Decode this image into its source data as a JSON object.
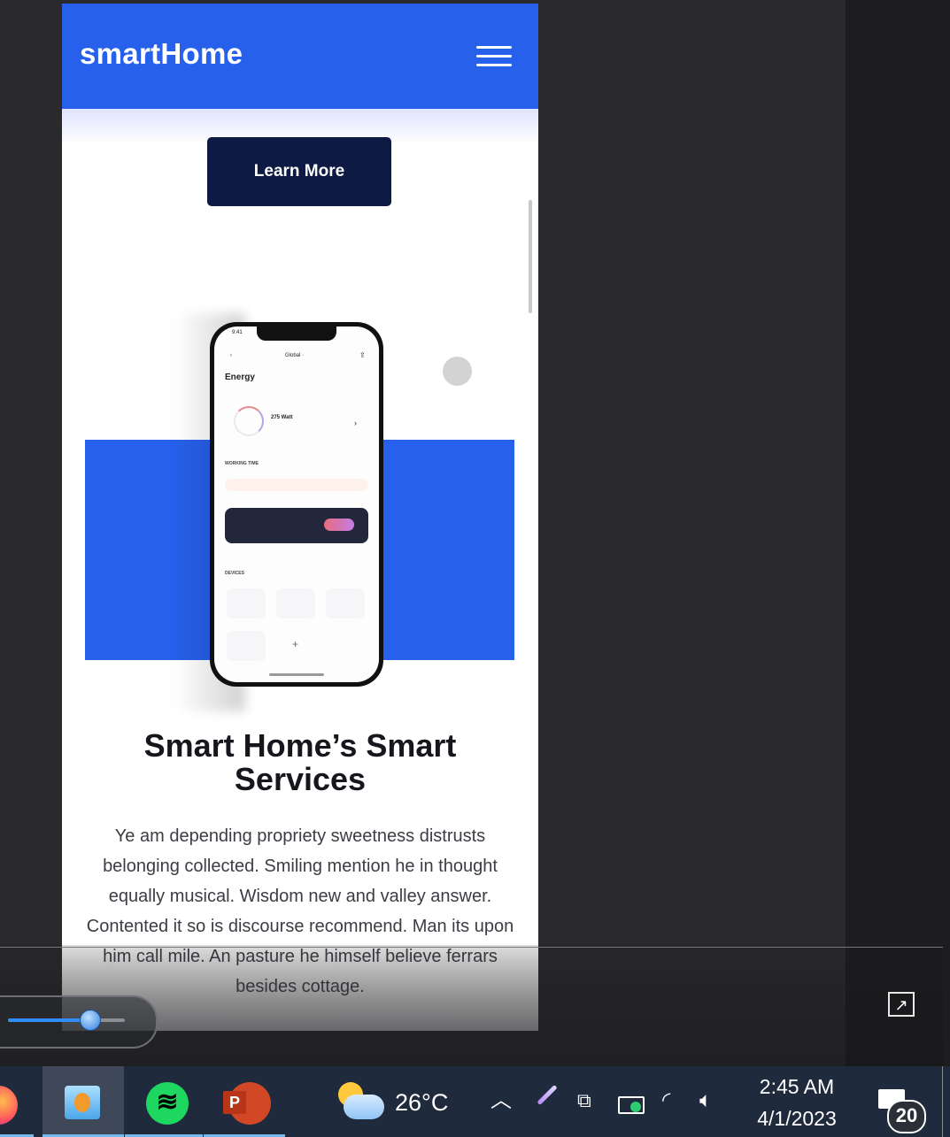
{
  "app": {
    "brand": "smartHome",
    "menu_icon": "hamburger-icon",
    "learn_more_label": "Learn More"
  },
  "phone_mockup": {
    "status_time": "9:41",
    "nav_center": "Global ·",
    "screen_title": "Energy",
    "watt_value": "275 Watt",
    "working_time_label": "WORKING TIME",
    "devices_label": "DEVICES"
  },
  "section": {
    "title": "Smart Home’s Smart Services",
    "body": "Ye am depending propriety sweetness distrusts belonging collected. Smiling mention he in thought equally musical. Wisdom new and valley answer. Contented it so is discourse recommend. Man its upon him call mile. An pasture he himself believe ferrars besides cottage."
  },
  "player": {
    "volume_percent": 70,
    "popout_icon": "popout-icon"
  },
  "taskbar": {
    "apps": [
      "firefox-icon",
      "media-player-icon",
      "spotify-icon",
      "powerpoint-icon"
    ],
    "temperature": "26°C",
    "weather_icon": "partly-cloudy-night-icon",
    "clock_time": "2:45 AM",
    "clock_date": "4/1/2023",
    "notification_count": "20"
  },
  "colors": {
    "brand_blue": "#2760ea",
    "button_navy": "#0d1a44",
    "taskbar": "#1f2a3d"
  }
}
